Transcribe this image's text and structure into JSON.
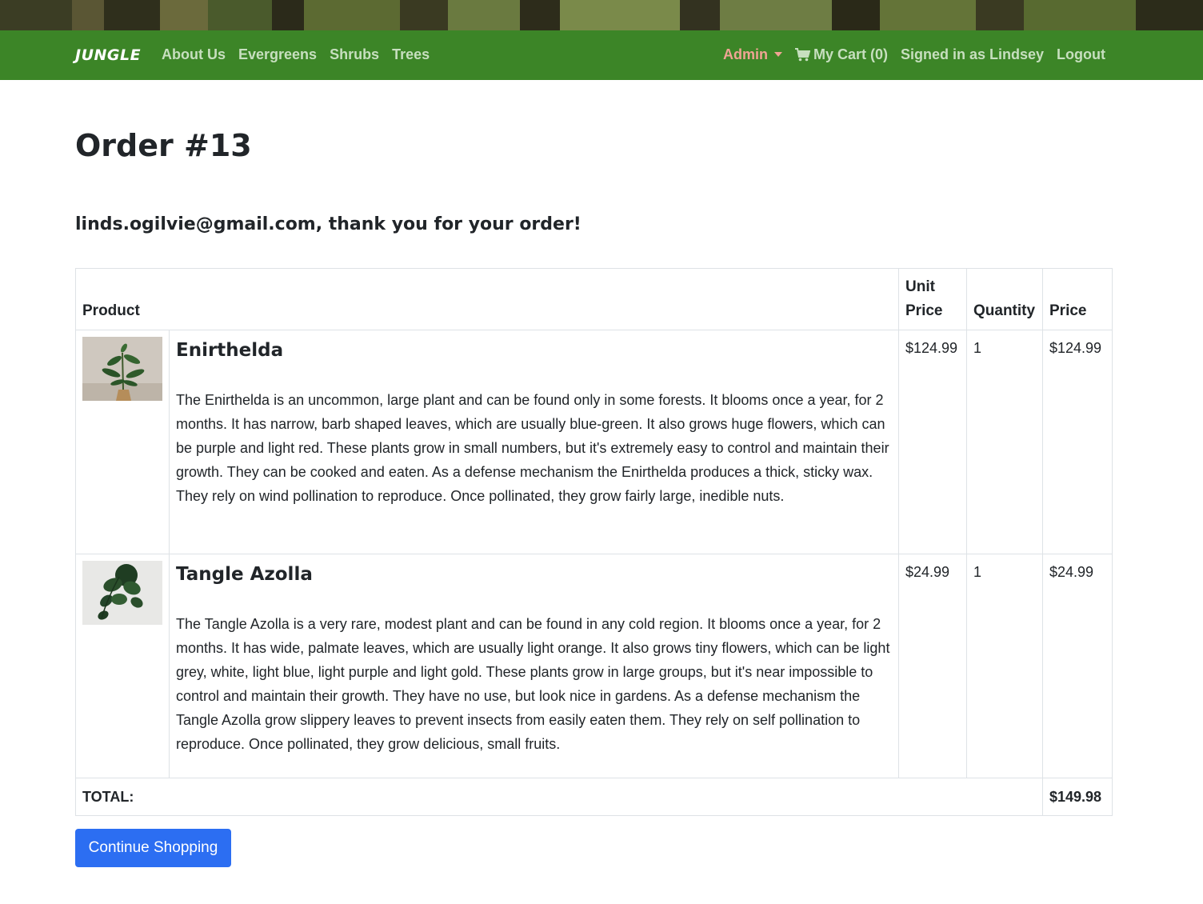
{
  "nav": {
    "brand": "JUNGLE",
    "links": [
      "About Us",
      "Evergreens",
      "Shrubs",
      "Trees"
    ],
    "admin": "Admin",
    "cart": "My Cart (0)",
    "signed_in": "Signed in as Lindsey",
    "logout": "Logout"
  },
  "page": {
    "title": "Order #13",
    "thanks": "linds.ogilvie@gmail.com, thank you for your order!"
  },
  "table": {
    "headers": {
      "product": "Product",
      "unit_price": "Unit Price",
      "quantity": "Quantity",
      "price": "Price"
    },
    "items": [
      {
        "name": "Enirthelda",
        "description": "The Enirthelda is an uncommon, large plant and can be found only in some forests. It blooms once a year, for 2 months. It has narrow, barb shaped leaves, which are usually blue-green. It also grows huge flowers, which can be purple and light red. These plants grow in small numbers, but it's extremely easy to control and maintain their growth. They can be cooked and eaten. As a defense mechanism the Enirthelda produces a thick, sticky wax. They rely on wind pollination to reproduce. Once pollinated, they grow fairly large, inedible nuts.",
        "unit_price": "$124.99",
        "quantity": "1",
        "price": "$124.99",
        "image": "potted-plant-image"
      },
      {
        "name": "Tangle Azolla",
        "description": "The Tangle Azolla is a very rare, modest plant and can be found in any cold region. It blooms once a year, for 2 months. It has wide, palmate leaves, which are usually light orange. It also grows tiny flowers, which can be light grey, white, light blue, light purple and light gold. These plants grow in large groups, but it's near impossible to control and maintain their growth. They have no use, but look nice in gardens. As a defense mechanism the Tangle Azolla grow slippery leaves to prevent insects from easily eaten them. They rely on self pollination to reproduce. Once pollinated, they grow delicious, small fruits.",
        "unit_price": "$24.99",
        "quantity": "1",
        "price": "$24.99",
        "image": "hanging-plant-image"
      }
    ],
    "total_label": "TOTAL:",
    "total_value": "$149.98"
  },
  "button": {
    "continue": "Continue Shopping"
  },
  "colors": {
    "navbar": "#3c8527",
    "button": "#2c6ef2",
    "admin": "#f0a494",
    "nav_link": "#c7dfbf"
  }
}
